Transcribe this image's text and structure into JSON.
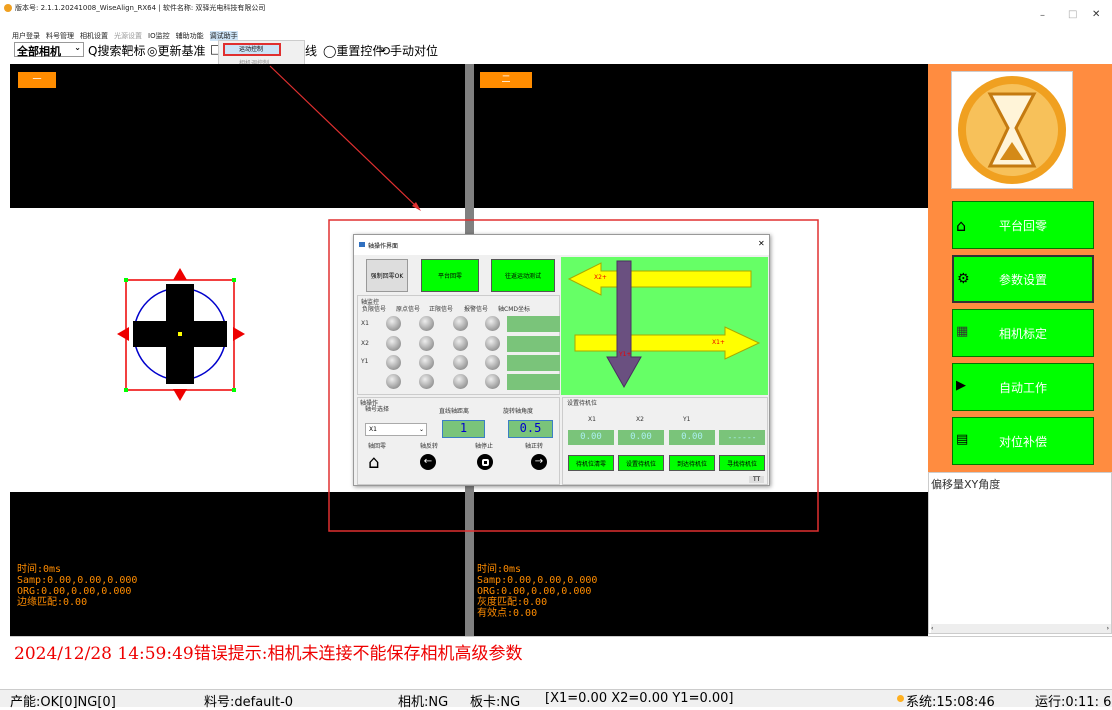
{
  "titlebar": {
    "text": "版本号: 2.1.1.20241008_WiseAlign_RX64 | 软件名称: 双驿光电科技有限公司",
    "min": "–",
    "max": "□",
    "close": "✕"
  },
  "menubar": {
    "items": [
      "用户登录",
      "料号管理",
      "相机设置",
      "光源设置",
      "IO监控",
      "辅助功能",
      "调试助手"
    ]
  },
  "dropdown": {
    "items": [
      "运动控制",
      "相机调控制"
    ]
  },
  "toolbar": {
    "camera_select": "全部相机",
    "search": "Q搜索靶标",
    "update": "◎更新基准",
    "hidden": "□",
    "line": "线",
    "reset": "◯重置控件",
    "manual": "⟲手动对位"
  },
  "views": {
    "left_tag": "一",
    "right_tag": "二",
    "left_info": [
      "时间:0ms",
      "Samp:0.00,0.00,0.000",
      "ORG:0.00,0.00,0.000",
      "边缘匹配:0.00"
    ],
    "right_info": [
      "时间:0ms",
      "Samp:0.00,0.00,0.000",
      "ORG:0.00,0.00,0.000",
      "灰度匹配:0.00",
      "有效点:0.00"
    ]
  },
  "sidebar": {
    "buttons": [
      "平台回零",
      "参数设置",
      "相机标定",
      "自动工作",
      "对位补偿"
    ],
    "offset_title": "偏移量XY角度"
  },
  "dialog": {
    "title": "轴操作界面",
    "close": "✕",
    "btn_force": "强制回零OK",
    "btn_home": "平台回零",
    "btn_reciprocate": "往返运动测试",
    "monitor_title": "轴监控",
    "monitor_cols": [
      "负限信号",
      "原点信号",
      "正限信号",
      "报警信号",
      "轴CMD坐标"
    ],
    "rows": [
      "X1",
      "X2",
      "Y1",
      ""
    ],
    "arrow_x2": "X2+",
    "arrow_x1": "X1+",
    "arrow_y": "Y1+",
    "op_title": "轴操作",
    "axis_select_label": "轴号选择",
    "line_dist_label": "直线轴距离",
    "rot_angle_label": "旋转轴角度",
    "axis_value": "X1",
    "line_dist_value": "1",
    "rot_angle_value": "0.5",
    "op_labels": [
      "轴回零",
      "轴反转",
      "轴停止",
      "轴正转"
    ],
    "wait_title": "设置待机位",
    "wait_cols": [
      "X1",
      "X2",
      "Y1"
    ],
    "wait_values": [
      "0.00",
      "0.00",
      "0.00",
      "------"
    ],
    "wait_btns": [
      "待机位清零",
      "设置待机位",
      "到达待机位",
      "寻找待机位"
    ],
    "tt": "TT"
  },
  "log": {
    "text": "2024/12/28 14:59:49错误提示:相机未连接不能保存相机高级参数"
  },
  "status": {
    "yield": "产能:OK[0]NG[0]",
    "part": "料号:default-0",
    "camera": "相机:NG",
    "board": "板卡:NG",
    "coords": "[X1=0.00 X2=0.00 Y1=0.00]",
    "sys": "系统:15:08:46",
    "run": "运行:0:11: 6"
  }
}
